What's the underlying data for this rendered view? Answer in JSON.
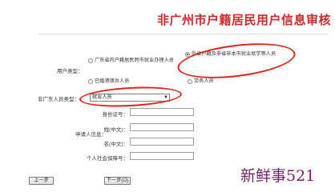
{
  "page_title": "非广州市户籍居民用户信息审核",
  "user_type": {
    "label": "用户类型：",
    "options": [
      "广东省内户籍居民跨市就业办理人员",
      "外省户籍及非省非本市就业就学等人员",
      "已婚港澳台人员",
      "劳务人员"
    ],
    "selected_index": 1
  },
  "non_local_type": {
    "label": "非广东人员类型：",
    "value": "就业人员"
  },
  "applicant": {
    "section_label": "申请人信息：",
    "fields": [
      {
        "label": "身份证号：",
        "value": ""
      },
      {
        "label": "姓(中文)：",
        "value": ""
      },
      {
        "label": "名(中文)：",
        "value": ""
      },
      {
        "label": "个人社会保障号：",
        "value": ""
      }
    ]
  },
  "buttons": {
    "prev": "上一步",
    "next": "下一步(O)"
  },
  "annotation_color": "#e2231a",
  "watermark": "新鲜事521"
}
